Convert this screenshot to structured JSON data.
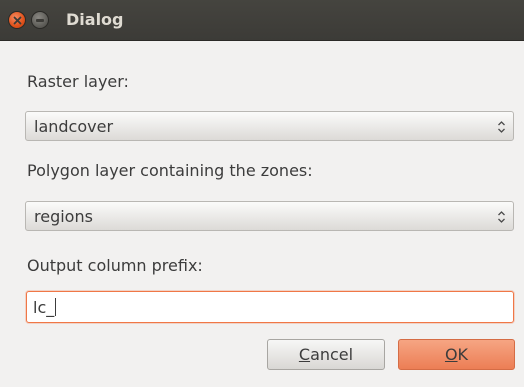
{
  "window": {
    "title": "Dialog"
  },
  "form": {
    "raster_label": "Raster layer:",
    "raster_value": "landcover",
    "polygon_label": "Polygon layer containing the zones:",
    "polygon_value": "regions",
    "prefix_label": "Output column prefix:",
    "prefix_value": "lc_"
  },
  "buttons": {
    "cancel_mnemonic": "C",
    "cancel_rest": "ancel",
    "ok_mnemonic": "O",
    "ok_rest": "K"
  },
  "colors": {
    "titlebar": "#3c3b37",
    "accent": "#f07746",
    "window_bg": "#f2f1f0"
  },
  "icons": {
    "close": "close-icon",
    "minimize": "minimize-icon",
    "combo_arrows": "up-down-arrows-icon"
  }
}
